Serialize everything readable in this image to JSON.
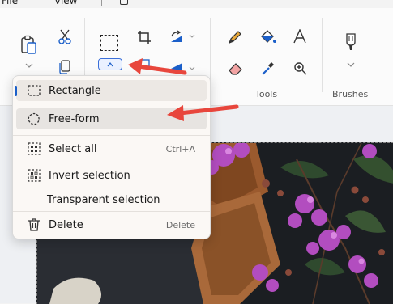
{
  "menubar": {
    "file": "File",
    "view": "View"
  },
  "ribbon": {
    "groups": {
      "tools": "Tools",
      "brushes": "Brushes"
    }
  },
  "dropdown": {
    "items": [
      {
        "label": "Rectangle",
        "shortcut": ""
      },
      {
        "label": "Free-form",
        "shortcut": ""
      },
      {
        "label": "Select all",
        "shortcut": "Ctrl+A"
      },
      {
        "label": "Invert selection",
        "shortcut": ""
      },
      {
        "label": "Transparent selection",
        "shortcut": ""
      },
      {
        "label": "Delete",
        "shortcut": "Delete"
      }
    ],
    "selected": "Rectangle",
    "hovered": "Free-form"
  },
  "colors": {
    "accent": "#1b5fc9",
    "arrow": "#e8463c",
    "flower": "#b24dbf"
  },
  "icons": [
    "paste-icon",
    "cut-icon",
    "copy-icon",
    "select-icon",
    "crop-icon",
    "rotate-icon",
    "flip-icon",
    "pencil-icon",
    "fill-icon",
    "text-icon",
    "eraser-icon",
    "color-picker-icon",
    "magnifier-icon",
    "brush-icon"
  ]
}
